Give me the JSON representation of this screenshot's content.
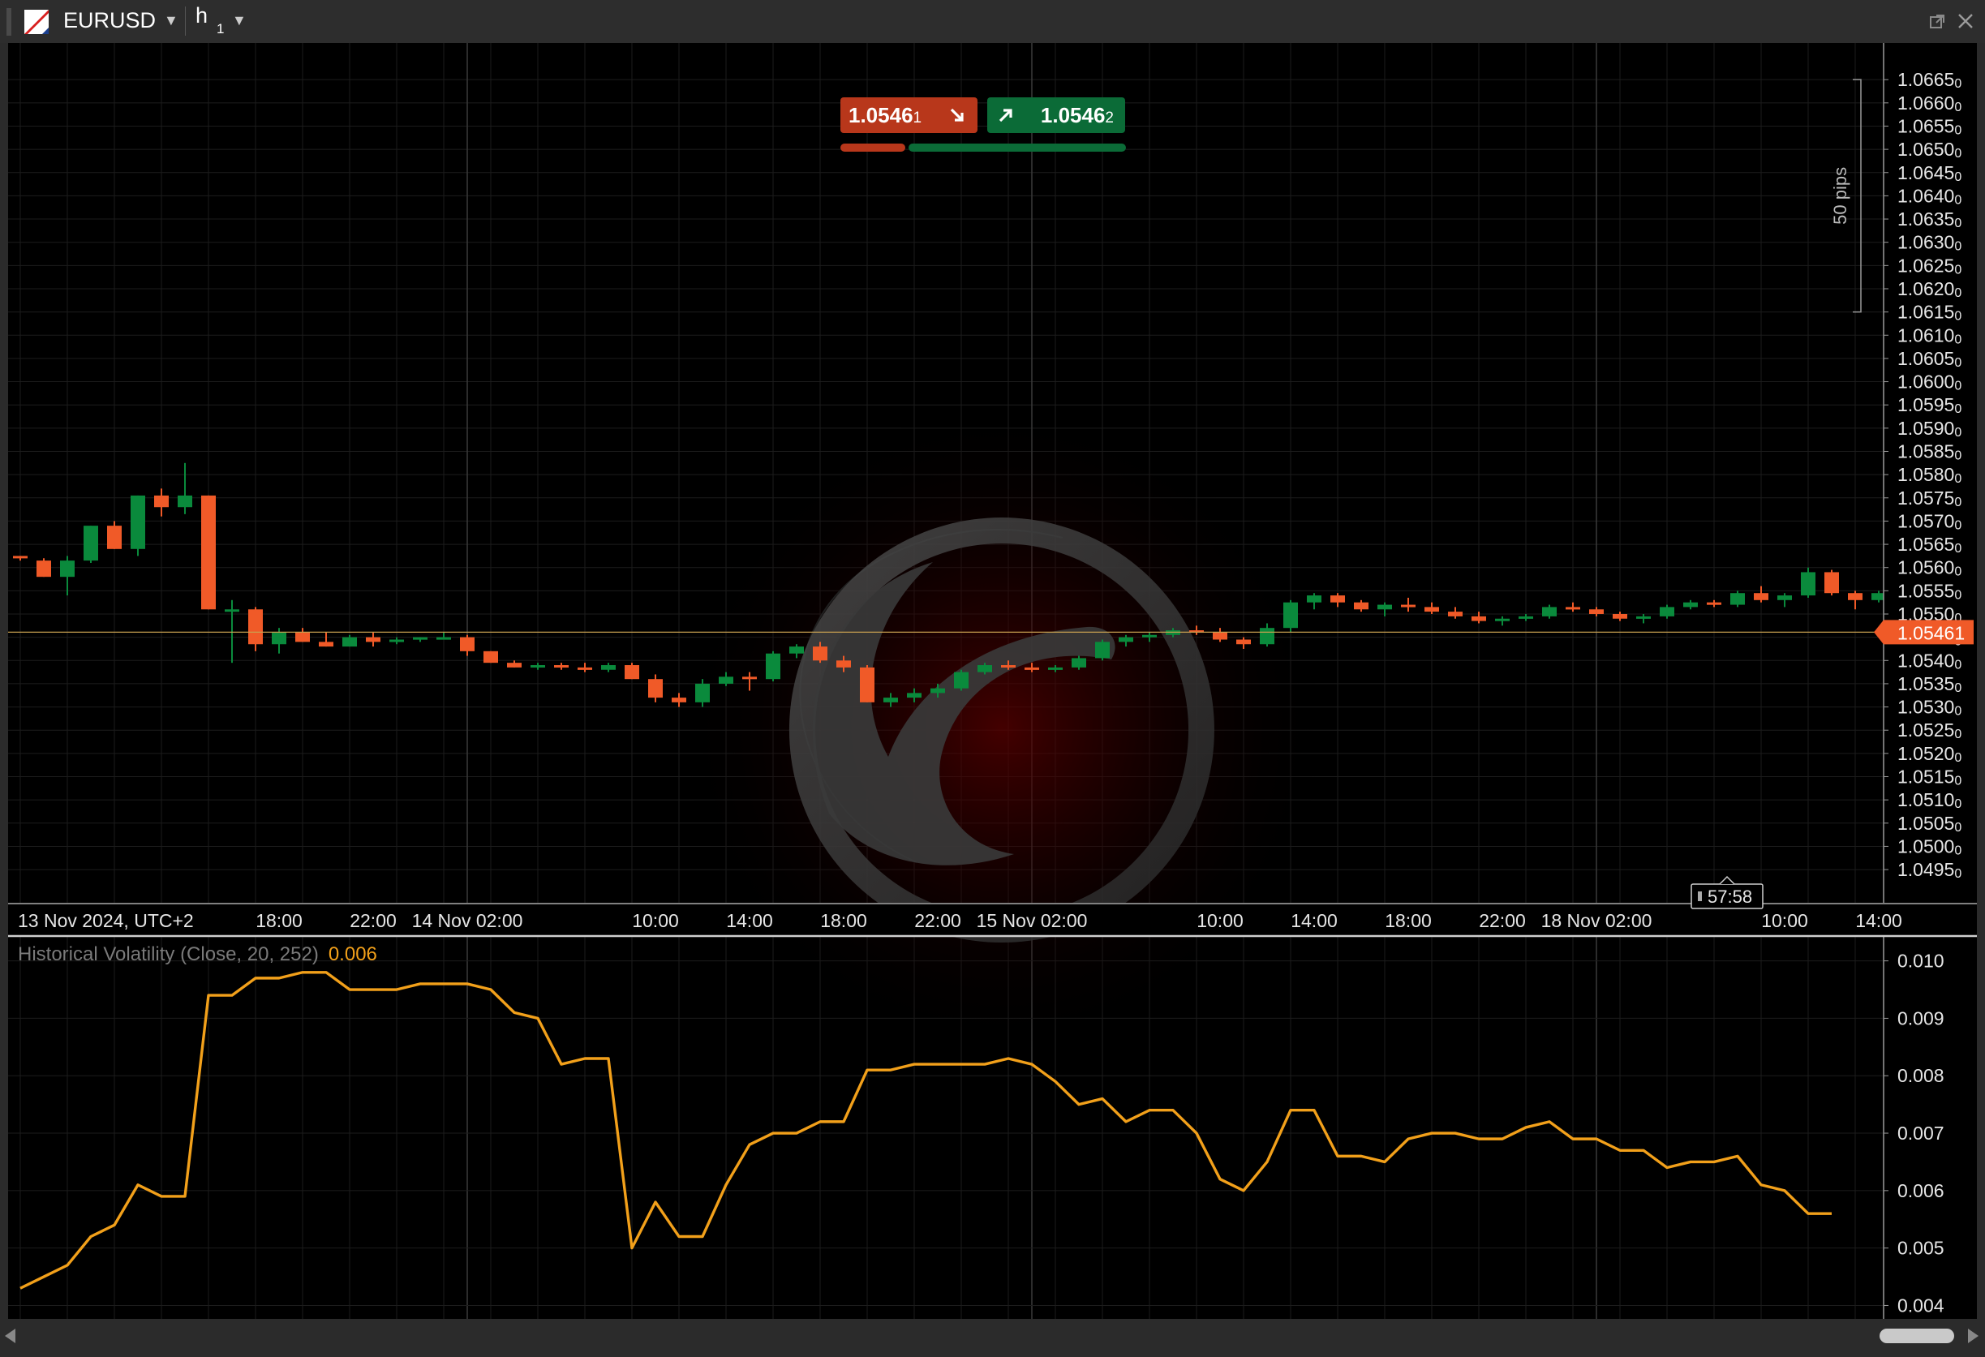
{
  "header": {
    "symbol": "EURUSD",
    "timeframe": "h",
    "timeframe_sub": "1",
    "icons": [
      "symbol-logo-icon",
      "chevron-down-icon",
      "detach-window-icon",
      "close-icon"
    ]
  },
  "trade_panel": {
    "sell": {
      "price_main": "1.0546",
      "price_sub": "1",
      "icon": "arrow-down-right-icon"
    },
    "buy": {
      "price_main": "1.0546",
      "price_sub": "2",
      "icon": "arrow-up-right-icon"
    }
  },
  "colors": {
    "bull": "#0a8a3c",
    "bear": "#f05a28",
    "price_line": "#c8a050",
    "grid": "#1c1c1c",
    "volatility": "#f2a01a",
    "axis_text": "#e6e6e6"
  },
  "chart_data": [
    {
      "type": "candlestick",
      "symbol": "EURUSD",
      "timeframe": "h1",
      "ylim": [
        1.0491,
        1.0668
      ],
      "y_ticks": [
        "1.0495",
        "1.0500",
        "1.0505",
        "1.0510",
        "1.0515",
        "1.0520",
        "1.0525",
        "1.0530",
        "1.0535",
        "1.0540",
        "1.0545",
        "1.0550",
        "1.0555",
        "1.0560",
        "1.0565",
        "1.0570",
        "1.0575",
        "1.0580",
        "1.0585",
        "1.0590",
        "1.0595",
        "1.0600",
        "1.0605",
        "1.0610",
        "1.0615",
        "1.0620",
        "1.0625",
        "1.0630",
        "1.0635",
        "1.0640",
        "1.0645",
        "1.0650",
        "1.0655",
        "1.0660",
        "1.0665"
      ],
      "y_tick_suffix": "0",
      "x_ticks": [
        {
          "index": 0,
          "label": "13 Nov 2024, UTC+2",
          "align": "start"
        },
        {
          "index": 11,
          "label": "18:00"
        },
        {
          "index": 15,
          "label": "22:00"
        },
        {
          "index": 19,
          "label": "14 Nov 02:00"
        },
        {
          "index": 27,
          "label": "10:00"
        },
        {
          "index": 31,
          "label": "14:00"
        },
        {
          "index": 35,
          "label": "18:00"
        },
        {
          "index": 39,
          "label": "22:00"
        },
        {
          "index": 43,
          "label": "15 Nov 02:00"
        },
        {
          "index": 51,
          "label": "10:00"
        },
        {
          "index": 55,
          "label": "14:00"
        },
        {
          "index": 59,
          "label": "18:00"
        },
        {
          "index": 63,
          "label": "22:00"
        },
        {
          "index": 67,
          "label": "18 Nov 02:00"
        },
        {
          "index": 75,
          "label": "10:00"
        },
        {
          "index": 79,
          "label": "14:00"
        }
      ],
      "current_price": "1.05461",
      "current_price_value": 1.05461,
      "countdown": "57:58",
      "pips_ruler": {
        "label": "50 pips",
        "from": 1.0615,
        "to": 1.0665
      },
      "candles": [
        {
          "o": 1.05625,
          "h": 1.05625,
          "l": 1.05615,
          "c": 1.0562
        },
        {
          "o": 1.05615,
          "h": 1.0562,
          "l": 1.0558,
          "c": 1.0558
        },
        {
          "o": 1.0558,
          "h": 1.05625,
          "l": 1.0554,
          "c": 1.05615
        },
        {
          "o": 1.05615,
          "h": 1.0569,
          "l": 1.0561,
          "c": 1.0569
        },
        {
          "o": 1.0569,
          "h": 1.057,
          "l": 1.0564,
          "c": 1.0564
        },
        {
          "o": 1.0564,
          "h": 1.05755,
          "l": 1.05625,
          "c": 1.05755
        },
        {
          "o": 1.05755,
          "h": 1.0577,
          "l": 1.0571,
          "c": 1.0573
        },
        {
          "o": 1.0573,
          "h": 1.05825,
          "l": 1.05715,
          "c": 1.05755
        },
        {
          "o": 1.05755,
          "h": 1.05755,
          "l": 1.0551,
          "c": 1.0551
        },
        {
          "o": 1.0551,
          "h": 1.0553,
          "l": 1.05395,
          "c": 1.0551
        },
        {
          "o": 1.0551,
          "h": 1.05515,
          "l": 1.0542,
          "c": 1.05435
        },
        {
          "o": 1.05435,
          "h": 1.0547,
          "l": 1.05415,
          "c": 1.0546
        },
        {
          "o": 1.0546,
          "h": 1.0547,
          "l": 1.0544,
          "c": 1.0544
        },
        {
          "o": 1.0544,
          "h": 1.0546,
          "l": 1.0543,
          "c": 1.0543
        },
        {
          "o": 1.0543,
          "h": 1.05455,
          "l": 1.0543,
          "c": 1.0545
        },
        {
          "o": 1.0545,
          "h": 1.0546,
          "l": 1.0543,
          "c": 1.0544
        },
        {
          "o": 1.0544,
          "h": 1.0545,
          "l": 1.05435,
          "c": 1.05445
        },
        {
          "o": 1.05445,
          "h": 1.0545,
          "l": 1.0544,
          "c": 1.0545
        },
        {
          "o": 1.0545,
          "h": 1.0546,
          "l": 1.05445,
          "c": 1.0545
        },
        {
          "o": 1.0545,
          "h": 1.05455,
          "l": 1.0541,
          "c": 1.0542
        },
        {
          "o": 1.0542,
          "h": 1.0542,
          "l": 1.05395,
          "c": 1.05395
        },
        {
          "o": 1.05395,
          "h": 1.054,
          "l": 1.05385,
          "c": 1.05385
        },
        {
          "o": 1.05385,
          "h": 1.05395,
          "l": 1.0538,
          "c": 1.0539
        },
        {
          "o": 1.0539,
          "h": 1.05395,
          "l": 1.0538,
          "c": 1.05385
        },
        {
          "o": 1.05385,
          "h": 1.05395,
          "l": 1.05375,
          "c": 1.0538
        },
        {
          "o": 1.0538,
          "h": 1.05395,
          "l": 1.05375,
          "c": 1.0539
        },
        {
          "o": 1.0539,
          "h": 1.05395,
          "l": 1.0536,
          "c": 1.0536
        },
        {
          "o": 1.0536,
          "h": 1.0537,
          "l": 1.0531,
          "c": 1.0532
        },
        {
          "o": 1.0532,
          "h": 1.0533,
          "l": 1.053,
          "c": 1.0531
        },
        {
          "o": 1.0531,
          "h": 1.0536,
          "l": 1.053,
          "c": 1.0535
        },
        {
          "o": 1.0535,
          "h": 1.05375,
          "l": 1.05345,
          "c": 1.05365
        },
        {
          "o": 1.05365,
          "h": 1.05375,
          "l": 1.05335,
          "c": 1.0536
        },
        {
          "o": 1.0536,
          "h": 1.0542,
          "l": 1.05355,
          "c": 1.05415
        },
        {
          "o": 1.05415,
          "h": 1.05435,
          "l": 1.05405,
          "c": 1.0543
        },
        {
          "o": 1.0543,
          "h": 1.0544,
          "l": 1.05395,
          "c": 1.054
        },
        {
          "o": 1.054,
          "h": 1.0541,
          "l": 1.05375,
          "c": 1.05385
        },
        {
          "o": 1.05385,
          "h": 1.0539,
          "l": 1.0531,
          "c": 1.0531
        },
        {
          "o": 1.0531,
          "h": 1.0533,
          "l": 1.053,
          "c": 1.0532
        },
        {
          "o": 1.0532,
          "h": 1.0534,
          "l": 1.0531,
          "c": 1.0533
        },
        {
          "o": 1.0533,
          "h": 1.0535,
          "l": 1.0532,
          "c": 1.0534
        },
        {
          "o": 1.0534,
          "h": 1.0538,
          "l": 1.05335,
          "c": 1.05375
        },
        {
          "o": 1.05375,
          "h": 1.05395,
          "l": 1.0537,
          "c": 1.0539
        },
        {
          "o": 1.0539,
          "h": 1.054,
          "l": 1.0538,
          "c": 1.05385
        },
        {
          "o": 1.05385,
          "h": 1.05395,
          "l": 1.05375,
          "c": 1.0538
        },
        {
          "o": 1.0538,
          "h": 1.0539,
          "l": 1.05375,
          "c": 1.05385
        },
        {
          "o": 1.05385,
          "h": 1.0541,
          "l": 1.0538,
          "c": 1.05405
        },
        {
          "o": 1.05405,
          "h": 1.05445,
          "l": 1.054,
          "c": 1.0544
        },
        {
          "o": 1.0544,
          "h": 1.05455,
          "l": 1.0543,
          "c": 1.0545
        },
        {
          "o": 1.0545,
          "h": 1.0546,
          "l": 1.0544,
          "c": 1.05455
        },
        {
          "o": 1.05455,
          "h": 1.0547,
          "l": 1.0545,
          "c": 1.05465
        },
        {
          "o": 1.05465,
          "h": 1.05475,
          "l": 1.05455,
          "c": 1.0546
        },
        {
          "o": 1.0546,
          "h": 1.0547,
          "l": 1.0544,
          "c": 1.05445
        },
        {
          "o": 1.05445,
          "h": 1.0545,
          "l": 1.05425,
          "c": 1.05435
        },
        {
          "o": 1.05435,
          "h": 1.0548,
          "l": 1.0543,
          "c": 1.0547
        },
        {
          "o": 1.0547,
          "h": 1.0553,
          "l": 1.0546,
          "c": 1.05525
        },
        {
          "o": 1.05525,
          "h": 1.05545,
          "l": 1.0551,
          "c": 1.0554
        },
        {
          "o": 1.0554,
          "h": 1.05545,
          "l": 1.05515,
          "c": 1.05525
        },
        {
          "o": 1.05525,
          "h": 1.0553,
          "l": 1.05505,
          "c": 1.0551
        },
        {
          "o": 1.0551,
          "h": 1.05525,
          "l": 1.05495,
          "c": 1.0552
        },
        {
          "o": 1.0552,
          "h": 1.05535,
          "l": 1.05505,
          "c": 1.05515
        },
        {
          "o": 1.05515,
          "h": 1.05525,
          "l": 1.055,
          "c": 1.05505
        },
        {
          "o": 1.05505,
          "h": 1.05515,
          "l": 1.0549,
          "c": 1.05495
        },
        {
          "o": 1.05495,
          "h": 1.05505,
          "l": 1.0548,
          "c": 1.05485
        },
        {
          "o": 1.05485,
          "h": 1.05495,
          "l": 1.05475,
          "c": 1.0549
        },
        {
          "o": 1.0549,
          "h": 1.055,
          "l": 1.05485,
          "c": 1.05495
        },
        {
          "o": 1.05495,
          "h": 1.0552,
          "l": 1.0549,
          "c": 1.05515
        },
        {
          "o": 1.05515,
          "h": 1.05525,
          "l": 1.05505,
          "c": 1.0551
        },
        {
          "o": 1.0551,
          "h": 1.05515,
          "l": 1.05495,
          "c": 1.055
        },
        {
          "o": 1.055,
          "h": 1.05505,
          "l": 1.05485,
          "c": 1.0549
        },
        {
          "o": 1.0549,
          "h": 1.055,
          "l": 1.0548,
          "c": 1.05495
        },
        {
          "o": 1.05495,
          "h": 1.0552,
          "l": 1.0549,
          "c": 1.05515
        },
        {
          "o": 1.05515,
          "h": 1.0553,
          "l": 1.0551,
          "c": 1.05525
        },
        {
          "o": 1.05525,
          "h": 1.0553,
          "l": 1.05515,
          "c": 1.0552
        },
        {
          "o": 1.0552,
          "h": 1.0555,
          "l": 1.05515,
          "c": 1.05545
        },
        {
          "o": 1.05545,
          "h": 1.0556,
          "l": 1.05525,
          "c": 1.0553
        },
        {
          "o": 1.0553,
          "h": 1.05545,
          "l": 1.05515,
          "c": 1.0554
        },
        {
          "o": 1.0554,
          "h": 1.056,
          "l": 1.05535,
          "c": 1.0559
        },
        {
          "o": 1.0559,
          "h": 1.05595,
          "l": 1.0554,
          "c": 1.05545
        },
        {
          "o": 1.05545,
          "h": 1.0555,
          "l": 1.0551,
          "c": 1.0553
        },
        {
          "o": 1.0553,
          "h": 1.0555,
          "l": 1.05525,
          "c": 1.05545
        },
        {
          "o": 1.05545,
          "h": 1.0555,
          "l": 1.05535,
          "c": 1.0554
        }
      ]
    },
    {
      "type": "line",
      "title": "Historical Volatility (Close, 20, 252)",
      "current_value": "0.006",
      "ylim": [
        0.00395,
        0.01015
      ],
      "y_ticks": [
        "0.004",
        "0.005",
        "0.006",
        "0.007",
        "0.008",
        "0.009",
        "0.010"
      ],
      "series": [
        {
          "values": [
            0.0043,
            0.0045,
            0.0047,
            0.0052,
            0.0054,
            0.0061,
            0.0059,
            0.0059,
            0.0094,
            0.0094,
            0.0097,
            0.0097,
            0.0098,
            0.0098,
            0.0095,
            0.0095,
            0.0095,
            0.0096,
            0.0096,
            0.0096,
            0.0095,
            0.0091,
            0.009,
            0.0082,
            0.0083,
            0.0083,
            0.005,
            0.0058,
            0.0052,
            0.0052,
            0.0061,
            0.0068,
            0.007,
            0.007,
            0.0072,
            0.0072,
            0.0081,
            0.0081,
            0.0082,
            0.0082,
            0.0082,
            0.0082,
            0.0083,
            0.0082,
            0.0079,
            0.0075,
            0.0076,
            0.0072,
            0.0074,
            0.0074,
            0.007,
            0.0062,
            0.006,
            0.0065,
            0.0074,
            0.0074,
            0.0066,
            0.0066,
            0.0065,
            0.0069,
            0.007,
            0.007,
            0.0069,
            0.0069,
            0.0071,
            0.0072,
            0.0069,
            0.0069,
            0.0067,
            0.0067,
            0.0064,
            0.0065,
            0.0065,
            0.0066,
            0.0061,
            0.006,
            0.0056,
            0.0056
          ]
        }
      ]
    }
  ]
}
